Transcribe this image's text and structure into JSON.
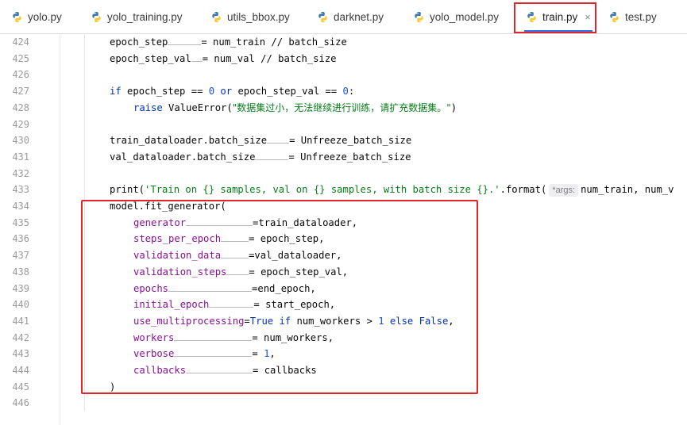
{
  "tabs": [
    {
      "label": "yolo.py",
      "active": false
    },
    {
      "label": "yolo_training.py",
      "active": false
    },
    {
      "label": "utils_bbox.py",
      "active": false
    },
    {
      "label": "darknet.py",
      "active": false
    },
    {
      "label": "yolo_model.py",
      "active": false
    },
    {
      "label": "train.py",
      "active": true,
      "close": "×"
    },
    {
      "label": "test.py",
      "active": false
    }
  ],
  "editor": {
    "line_numbers": [
      "424",
      "425",
      "426",
      "427",
      "428",
      "429",
      "430",
      "431",
      "432",
      "433",
      "434",
      "435",
      "436",
      "437",
      "438",
      "439",
      "440",
      "441",
      "442",
      "443",
      "444",
      "445",
      "446"
    ],
    "lines": {
      "l424": {
        "name": "epoch_step",
        "value": "= num_train // batch_size"
      },
      "l425": {
        "name": "epoch_step_val",
        "value": "= num_val // batch_size"
      },
      "l427": {
        "kw_if": "if",
        "a": " epoch_step == ",
        "n0": "0",
        "kw_or": " or ",
        "b": "epoch_step_val == ",
        "n1": "0",
        "c": ":"
      },
      "l428": {
        "kw": "raise",
        "func": " ValueError(",
        "str": "\"数据集过小，无法继续进行训练，请扩充数据集。\"",
        "end": ")"
      },
      "l430": {
        "name": "train_dataloader.batch_size",
        "value": "= Unfreeze_batch_size"
      },
      "l431": {
        "name": "val_dataloader.batch_size",
        "value": "= Unfreeze_batch_size"
      },
      "l433": {
        "func": "print(",
        "str": "'Train on {} samples, val on {} samples, with batch size {}.'",
        "mid": ".format(",
        "hint": "*args:",
        "rest": "num_train, num_v"
      },
      "l434": {
        "text": "model.fit_generator("
      },
      "l435": {
        "param": "generator",
        "value": "=train_dataloader,"
      },
      "l436": {
        "param": "steps_per_epoch",
        "value": "= epoch_step,"
      },
      "l437": {
        "param": "validation_data",
        "value": "=val_dataloader,"
      },
      "l438": {
        "param": "validation_steps",
        "value": "= epoch_step_val,"
      },
      "l439": {
        "param": "epochs",
        "value": "=end_epoch,"
      },
      "l440": {
        "param": "initial_epoch",
        "value": "= start_epoch,"
      },
      "l441": {
        "param": "use_multiprocessing",
        "eq": "=",
        "kw_true": "True",
        "kw_if": " if ",
        "mid": "num_workers > ",
        "num": "1",
        "kw_else": " else ",
        "kw_false": "False",
        "end": ","
      },
      "l442": {
        "param": "workers",
        "value": "= num_workers,"
      },
      "l443": {
        "param": "verbose",
        "eq": "= ",
        "num": "1",
        "end": ","
      },
      "l444": {
        "param": "callbacks",
        "value": "= callbacks"
      },
      "l445": {
        "text": ")"
      }
    }
  },
  "colors": {
    "annotation": "#e0262b",
    "keyword": "#0033b3",
    "number": "#1750eb",
    "string": "#067d17",
    "parameter": "#871094",
    "tab_underline": "#3574f0"
  }
}
